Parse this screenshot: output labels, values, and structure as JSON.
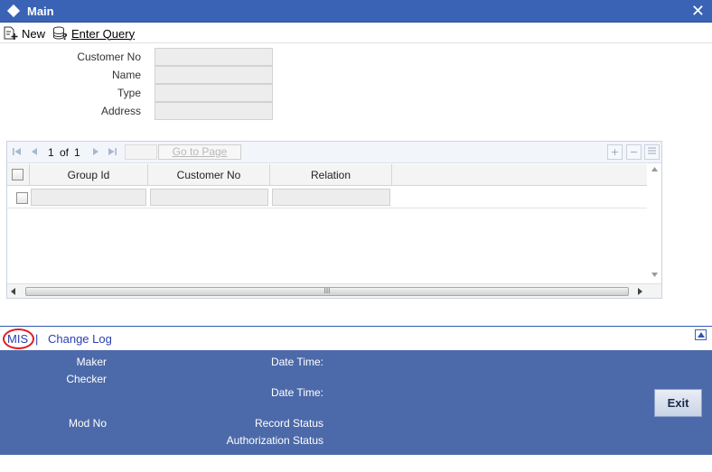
{
  "window": {
    "title": "Main",
    "close_glyph": "✕"
  },
  "toolbar": {
    "new_label": "New",
    "enter_query_label": "Enter Query"
  },
  "form": {
    "fields": [
      {
        "label": "Customer No",
        "value": ""
      },
      {
        "label": "Name",
        "value": ""
      },
      {
        "label": "Type",
        "value": ""
      },
      {
        "label": "Address",
        "value": ""
      }
    ]
  },
  "grid": {
    "pagination": {
      "current": "1",
      "of_label": "of",
      "total": "1",
      "page_input": "",
      "goto_label": "Go to Page"
    },
    "columns": [
      "Group Id",
      "Customer No",
      "Relation"
    ],
    "rows": [
      {
        "group_id": "",
        "customer_no": "",
        "relation": ""
      }
    ],
    "hscroll_grip": "III"
  },
  "bottom_tabs": {
    "mis_label": "MIS",
    "separator": "|",
    "change_log_label": "Change Log"
  },
  "audit": {
    "maker_label": "Maker",
    "checker_label": "Checker",
    "maker_date_label": "Date Time:",
    "checker_date_label": "Date Time:",
    "mod_no_label": "Mod No",
    "record_status_label": "Record Status",
    "auth_status_label": "Authorization Status",
    "exit_label": "Exit"
  },
  "colors": {
    "title_bar": "#3a63b5",
    "audit_panel": "#4c6aa9",
    "link": "#2a3fb0",
    "highlight_circle": "#e21b1b"
  }
}
